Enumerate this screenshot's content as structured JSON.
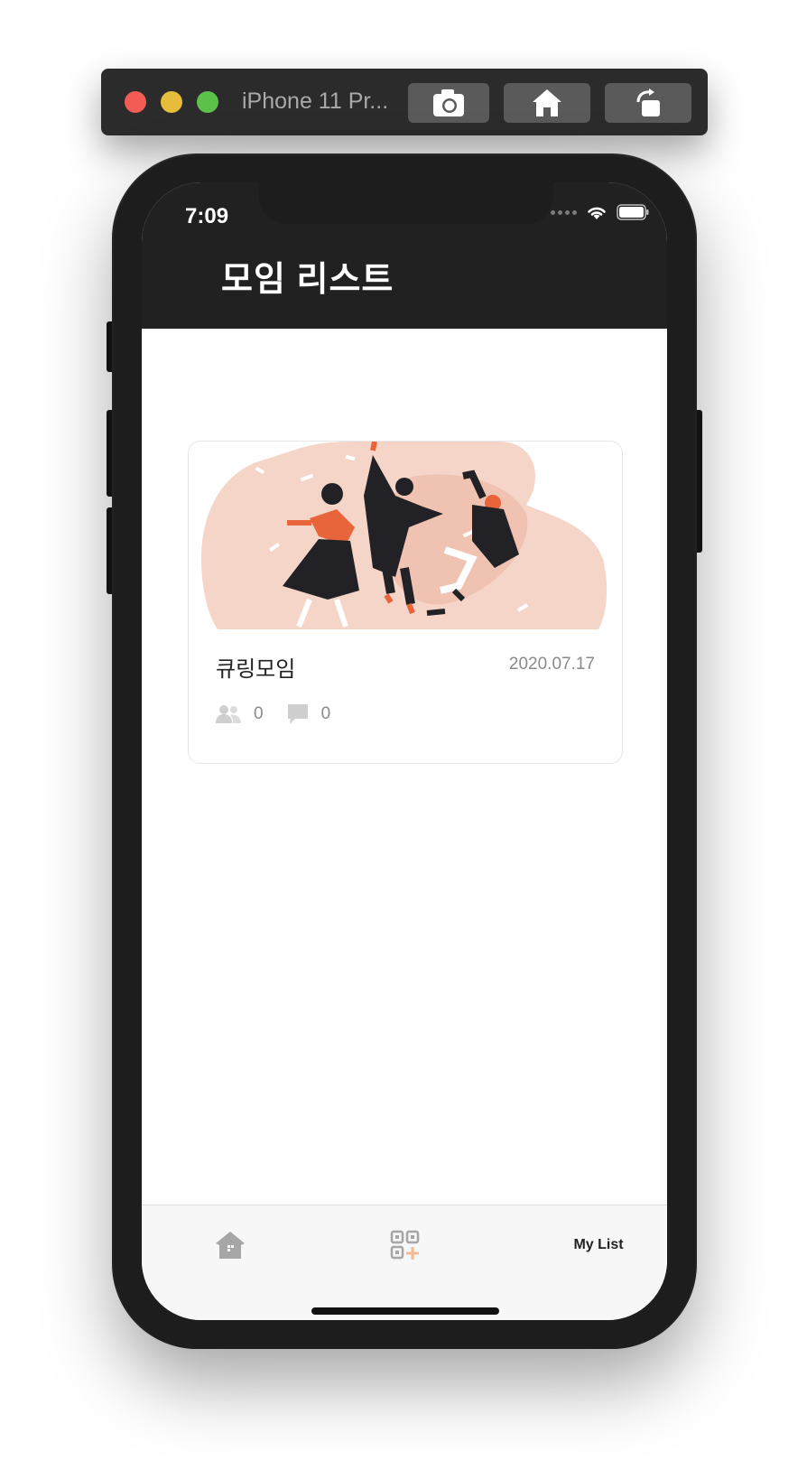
{
  "simulator": {
    "title": "iPhone 11 Pr...",
    "buttons": [
      "camera-icon",
      "home-icon",
      "rotate-icon"
    ]
  },
  "status_bar": {
    "time": "7:09",
    "icons": [
      "signal-dots-icon",
      "wifi-icon",
      "battery-icon"
    ]
  },
  "header": {
    "title": "모임 리스트"
  },
  "meetings": [
    {
      "title": "큐링모임",
      "date": "2020.07.17",
      "members_count": "0",
      "comments_count": "0",
      "illustration": "dancing-people-illustration"
    }
  ],
  "tabbar": {
    "items": [
      {
        "icon": "home-icon"
      },
      {
        "icon": "qr-add-icon"
      },
      {
        "label": "My List"
      }
    ],
    "active": "My List"
  },
  "colors": {
    "header_bg": "#212121",
    "accent": "#e8643a",
    "illustration_bg": "#f6d5c9"
  }
}
